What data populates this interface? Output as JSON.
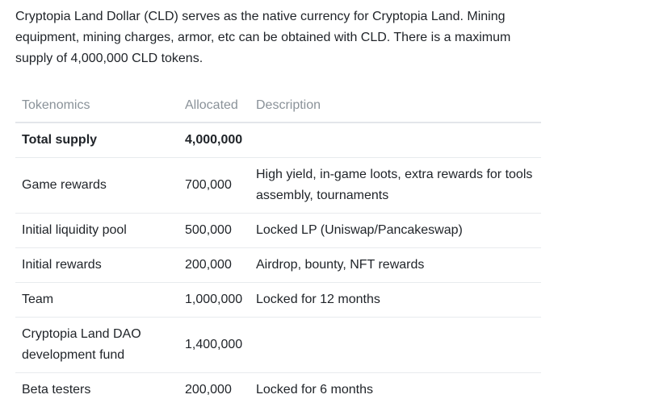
{
  "intro_text": "Cryptopia Land Dollar (CLD) serves as the native currency for Cryptopia Land. Mining equipment, mining charges, armor, etc can be obtained with CLD. There is a maximum supply of 4,000,000 CLD tokens.",
  "table": {
    "headers": [
      "Tokenomics",
      "Allocated",
      "Description"
    ],
    "rows": [
      {
        "tokenomics": "Total supply",
        "allocated": "4,000,000",
        "description": ""
      },
      {
        "tokenomics": "Game rewards",
        "allocated": "700,000",
        "description": "High yield, in-game loots, extra rewards for tools assembly, tournaments"
      },
      {
        "tokenomics": "Initial liquidity pool",
        "allocated": "500,000",
        "description": "Locked LP (Uniswap/Pancakeswap)"
      },
      {
        "tokenomics": "Initial rewards",
        "allocated": "200,000",
        "description": "Airdrop, bounty, NFT rewards"
      },
      {
        "tokenomics": "Team",
        "allocated": "1,000,000",
        "description": "Locked for 12 months"
      },
      {
        "tokenomics": "Cryptopia Land DAO development fund",
        "allocated": "1,400,000",
        "description": ""
      },
      {
        "tokenomics": "Beta testers",
        "allocated": "200,000",
        "description": "Locked for 6 months"
      }
    ]
  }
}
